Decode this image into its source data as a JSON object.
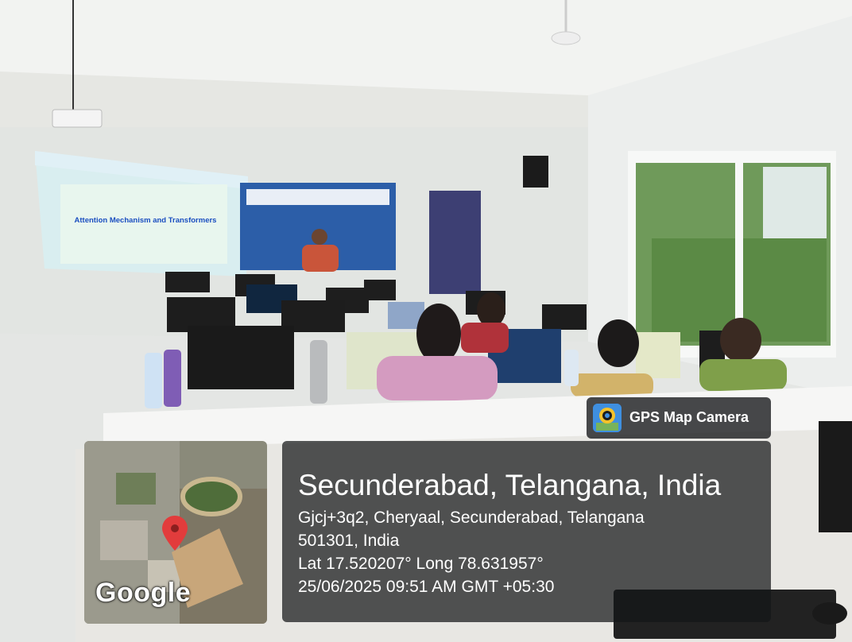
{
  "badge": {
    "label": "GPS Map Camera",
    "icon": "map-pin-camera-icon"
  },
  "map": {
    "logo": "Google",
    "marker_icon": "location-pin-icon"
  },
  "location": {
    "title": "Secunderabad, Telangana, India",
    "address_line1": "Gjcj+3q2, Cheryaal, Secunderabad, Telangana",
    "address_line2": "501301, India",
    "coordinates": "Lat 17.520207° Long 78.631957°",
    "datetime": "25/06/2025 09:51 AM GMT +05:30"
  },
  "projector_screen": {
    "slide_title": "Attention Mechanism and Transformers"
  },
  "colors": {
    "overlay": "#141618",
    "badge_icon": "#2f7fd6",
    "slide_text": "#1a4ec0",
    "banner": "#2c5ea8"
  }
}
